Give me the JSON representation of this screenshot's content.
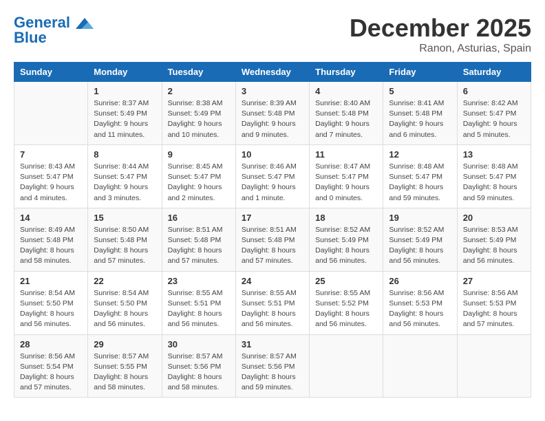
{
  "header": {
    "logo_line1": "General",
    "logo_line2": "Blue",
    "month": "December 2025",
    "location": "Ranon, Asturias, Spain"
  },
  "weekdays": [
    "Sunday",
    "Monday",
    "Tuesday",
    "Wednesday",
    "Thursday",
    "Friday",
    "Saturday"
  ],
  "weeks": [
    [
      {
        "day": "",
        "info": ""
      },
      {
        "day": "1",
        "info": "Sunrise: 8:37 AM\nSunset: 5:49 PM\nDaylight: 9 hours\nand 11 minutes."
      },
      {
        "day": "2",
        "info": "Sunrise: 8:38 AM\nSunset: 5:49 PM\nDaylight: 9 hours\nand 10 minutes."
      },
      {
        "day": "3",
        "info": "Sunrise: 8:39 AM\nSunset: 5:48 PM\nDaylight: 9 hours\nand 9 minutes."
      },
      {
        "day": "4",
        "info": "Sunrise: 8:40 AM\nSunset: 5:48 PM\nDaylight: 9 hours\nand 7 minutes."
      },
      {
        "day": "5",
        "info": "Sunrise: 8:41 AM\nSunset: 5:48 PM\nDaylight: 9 hours\nand 6 minutes."
      },
      {
        "day": "6",
        "info": "Sunrise: 8:42 AM\nSunset: 5:47 PM\nDaylight: 9 hours\nand 5 minutes."
      }
    ],
    [
      {
        "day": "7",
        "info": "Sunrise: 8:43 AM\nSunset: 5:47 PM\nDaylight: 9 hours\nand 4 minutes."
      },
      {
        "day": "8",
        "info": "Sunrise: 8:44 AM\nSunset: 5:47 PM\nDaylight: 9 hours\nand 3 minutes."
      },
      {
        "day": "9",
        "info": "Sunrise: 8:45 AM\nSunset: 5:47 PM\nDaylight: 9 hours\nand 2 minutes."
      },
      {
        "day": "10",
        "info": "Sunrise: 8:46 AM\nSunset: 5:47 PM\nDaylight: 9 hours\nand 1 minute."
      },
      {
        "day": "11",
        "info": "Sunrise: 8:47 AM\nSunset: 5:47 PM\nDaylight: 9 hours\nand 0 minutes."
      },
      {
        "day": "12",
        "info": "Sunrise: 8:48 AM\nSunset: 5:47 PM\nDaylight: 8 hours\nand 59 minutes."
      },
      {
        "day": "13",
        "info": "Sunrise: 8:48 AM\nSunset: 5:47 PM\nDaylight: 8 hours\nand 59 minutes."
      }
    ],
    [
      {
        "day": "14",
        "info": "Sunrise: 8:49 AM\nSunset: 5:48 PM\nDaylight: 8 hours\nand 58 minutes."
      },
      {
        "day": "15",
        "info": "Sunrise: 8:50 AM\nSunset: 5:48 PM\nDaylight: 8 hours\nand 57 minutes."
      },
      {
        "day": "16",
        "info": "Sunrise: 8:51 AM\nSunset: 5:48 PM\nDaylight: 8 hours\nand 57 minutes."
      },
      {
        "day": "17",
        "info": "Sunrise: 8:51 AM\nSunset: 5:48 PM\nDaylight: 8 hours\nand 57 minutes."
      },
      {
        "day": "18",
        "info": "Sunrise: 8:52 AM\nSunset: 5:49 PM\nDaylight: 8 hours\nand 56 minutes."
      },
      {
        "day": "19",
        "info": "Sunrise: 8:52 AM\nSunset: 5:49 PM\nDaylight: 8 hours\nand 56 minutes."
      },
      {
        "day": "20",
        "info": "Sunrise: 8:53 AM\nSunset: 5:49 PM\nDaylight: 8 hours\nand 56 minutes."
      }
    ],
    [
      {
        "day": "21",
        "info": "Sunrise: 8:54 AM\nSunset: 5:50 PM\nDaylight: 8 hours\nand 56 minutes."
      },
      {
        "day": "22",
        "info": "Sunrise: 8:54 AM\nSunset: 5:50 PM\nDaylight: 8 hours\nand 56 minutes."
      },
      {
        "day": "23",
        "info": "Sunrise: 8:55 AM\nSunset: 5:51 PM\nDaylight: 8 hours\nand 56 minutes."
      },
      {
        "day": "24",
        "info": "Sunrise: 8:55 AM\nSunset: 5:51 PM\nDaylight: 8 hours\nand 56 minutes."
      },
      {
        "day": "25",
        "info": "Sunrise: 8:55 AM\nSunset: 5:52 PM\nDaylight: 8 hours\nand 56 minutes."
      },
      {
        "day": "26",
        "info": "Sunrise: 8:56 AM\nSunset: 5:53 PM\nDaylight: 8 hours\nand 56 minutes."
      },
      {
        "day": "27",
        "info": "Sunrise: 8:56 AM\nSunset: 5:53 PM\nDaylight: 8 hours\nand 57 minutes."
      }
    ],
    [
      {
        "day": "28",
        "info": "Sunrise: 8:56 AM\nSunset: 5:54 PM\nDaylight: 8 hours\nand 57 minutes."
      },
      {
        "day": "29",
        "info": "Sunrise: 8:57 AM\nSunset: 5:55 PM\nDaylight: 8 hours\nand 58 minutes."
      },
      {
        "day": "30",
        "info": "Sunrise: 8:57 AM\nSunset: 5:56 PM\nDaylight: 8 hours\nand 58 minutes."
      },
      {
        "day": "31",
        "info": "Sunrise: 8:57 AM\nSunset: 5:56 PM\nDaylight: 8 hours\nand 59 minutes."
      },
      {
        "day": "",
        "info": ""
      },
      {
        "day": "",
        "info": ""
      },
      {
        "day": "",
        "info": ""
      }
    ]
  ]
}
